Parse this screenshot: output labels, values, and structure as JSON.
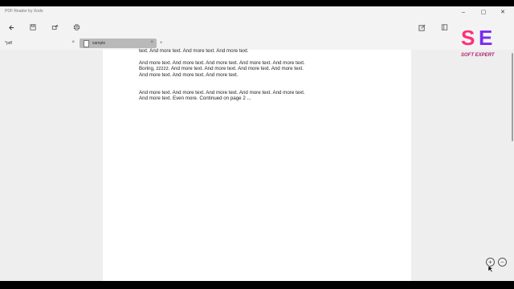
{
  "window": {
    "title": "PDF Reader by Xodo",
    "minimize": "–",
    "maximize": "▢",
    "close": "✕"
  },
  "tabs": [
    {
      "label": "*pdf",
      "close": "×"
    },
    {
      "label": "sample",
      "close": "×"
    }
  ],
  "new_tab": "+",
  "document": {
    "paragraphs": [
      "text. And more text. And more text. And more text.",
      "And more text. And more text. And more text. And more text. And more text. Boring, zzzzz. And more text. And more text. And more text. And more text. And more text. And more text. And more text.",
      "And more text. And more text. And more text. And more text. And more text. And more text. Even more. Continued on page 2 ..."
    ]
  },
  "zoom": {
    "in": "+",
    "out": "−"
  },
  "watermark": {
    "initials": "SE",
    "name": "SOFT EXPERT",
    "colors": [
      "#ff2f7a",
      "#7b2cf2"
    ]
  }
}
